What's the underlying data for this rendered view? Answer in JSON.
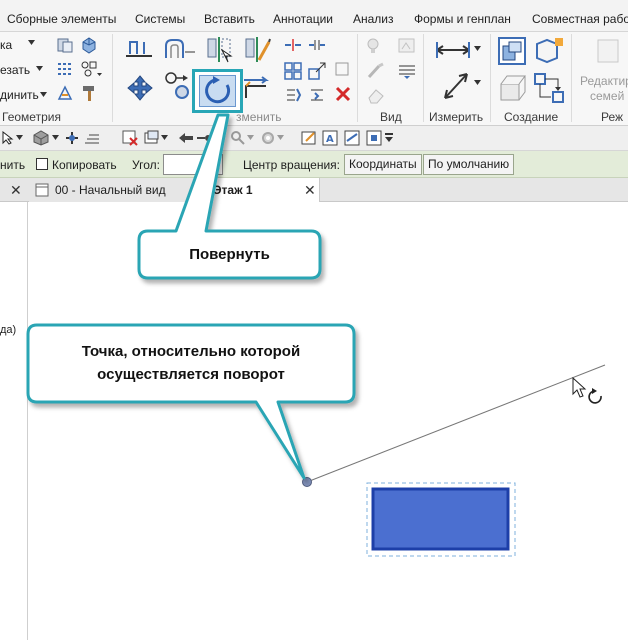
{
  "menu": {
    "tabs": [
      "Сборные элементы",
      "Системы",
      "Вставить",
      "Аннотации",
      "Анализ",
      "Формы и генплан",
      "Совместная рабо"
    ]
  },
  "ribbon": {
    "left_items": [
      "ка",
      "езать",
      "динить"
    ],
    "panels": {
      "geometry": "Геометрия",
      "modify": "зменить",
      "view": "Вид",
      "measure": "Измерить",
      "create": "Создание",
      "mode": "Реж"
    },
    "edit_family": {
      "line1": "Редактир",
      "line2": "семей"
    }
  },
  "options_bar": {
    "cut_label": "нить",
    "copy_label": "Копировать",
    "angle_label": "Угол:",
    "angle_value": "",
    "center_label": "Центр вращения:",
    "coordinates_button": "Координаты",
    "default_button": "По умолчанию"
  },
  "view_tabs": [
    {
      "label": "00 - Начальный вид",
      "active": false
    },
    {
      "label": "Этаж 1",
      "active": true
    }
  ],
  "browser": {
    "cut_text": "да)"
  },
  "callouts": {
    "rotate": "Повернуть",
    "point_line1": "Точка, относительно которой",
    "point_line2": "осуществляется поворот"
  },
  "colors": {
    "callout_border": "#2aa5b4",
    "highlight": "#28a6b6",
    "rectangle_fill": "#4b6fd0",
    "rectangle_border": "#1d3fa8",
    "options_bar_bg": "#e3ecd9"
  },
  "icons": {
    "rotate": "rotate-icon",
    "move": "move-icon",
    "align": "align-icon",
    "cursor": "rotate-cursor-icon"
  }
}
